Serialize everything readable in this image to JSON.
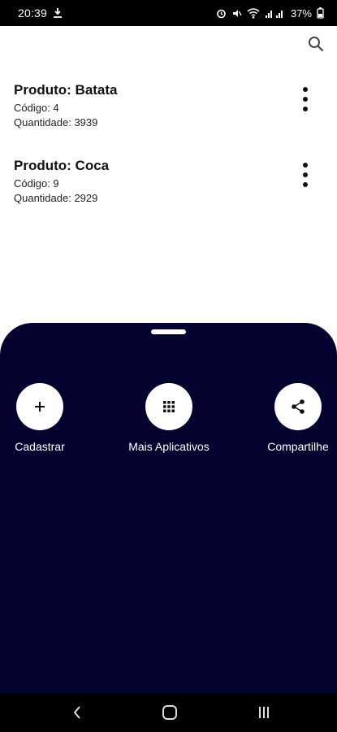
{
  "status_bar": {
    "time": "20:39",
    "battery": "37%",
    "icons": [
      "notification-icon",
      "alarm-icon",
      "mute-icon",
      "wifi-icon",
      "signal-icon",
      "battery-icon"
    ]
  },
  "toolbar": {
    "search_icon": "search-icon"
  },
  "products": [
    {
      "name": "Produto: Batata",
      "code": "Código: 4",
      "quantity": "Quantidade: 3939"
    },
    {
      "name": "Produto: Coca",
      "code": "Código: 9",
      "quantity": "Quantidade: 2929"
    }
  ],
  "sheet": {
    "actions": [
      {
        "label": "Cadastrar",
        "icon": "plus-icon"
      },
      {
        "label": "Mais Aplicativos",
        "icon": "grid-icon"
      },
      {
        "label": "Compartilhe",
        "icon": "share-icon"
      }
    ],
    "background": "#04032f"
  },
  "nav_bar": {
    "buttons": [
      "back-icon",
      "home-icon",
      "recents-icon"
    ]
  }
}
